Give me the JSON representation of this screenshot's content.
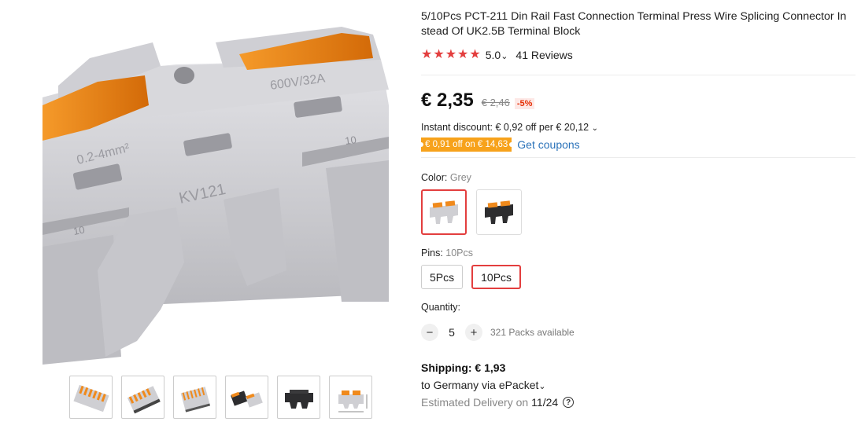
{
  "product": {
    "title": "5/10Pcs PCT-211 Din Rail Fast Connection Terminal Press Wire Splicing Connector In stead Of UK2.5B Terminal Block",
    "rating": {
      "stars": 5,
      "score": "5.0",
      "reviews": "41 Reviews"
    },
    "price": {
      "current": "€ 2,35",
      "original": "€ 2,46",
      "discount": "-5%"
    },
    "instant_discount": "Instant discount: € 0,92 off per € 20,12",
    "coupon": {
      "badge": "€ 0,91 off on € 14,63",
      "link": "Get coupons"
    },
    "image_markings": {
      "rating_text": "600V/32A",
      "range_text": "0.2-4mm²",
      "model_text": "KV121",
      "strip_length": "10"
    }
  },
  "color": {
    "label": "Color:",
    "selected": "Grey",
    "options": [
      {
        "name": "grey-option",
        "body": "#cfcfd3",
        "lever": "#f08a1c"
      },
      {
        "name": "black-option",
        "body": "#2d2d2f",
        "lever": "#f08a1c"
      }
    ]
  },
  "pins": {
    "label": "Pins:",
    "selected": "10Pcs",
    "options": [
      "5Pcs",
      "10Pcs"
    ]
  },
  "quantity": {
    "label": "Quantity:",
    "value": "5",
    "minus": "−",
    "plus": "+",
    "available": "321 Packs available"
  },
  "shipping": {
    "title": "Shipping: € 1,93",
    "route": "to Germany via ePacket",
    "delivery_label": "Estimated Delivery on",
    "delivery_date": "11/24",
    "help_glyph": "?"
  },
  "glyphs": {
    "star": "★",
    "chevron": "⌄"
  },
  "colors": {
    "accent": "#e33e3e",
    "coupon_bg": "#f7a21b",
    "link": "#2a72b9",
    "terminal_grey": "#cfcfd3",
    "lever_orange": "#f08a1c"
  }
}
